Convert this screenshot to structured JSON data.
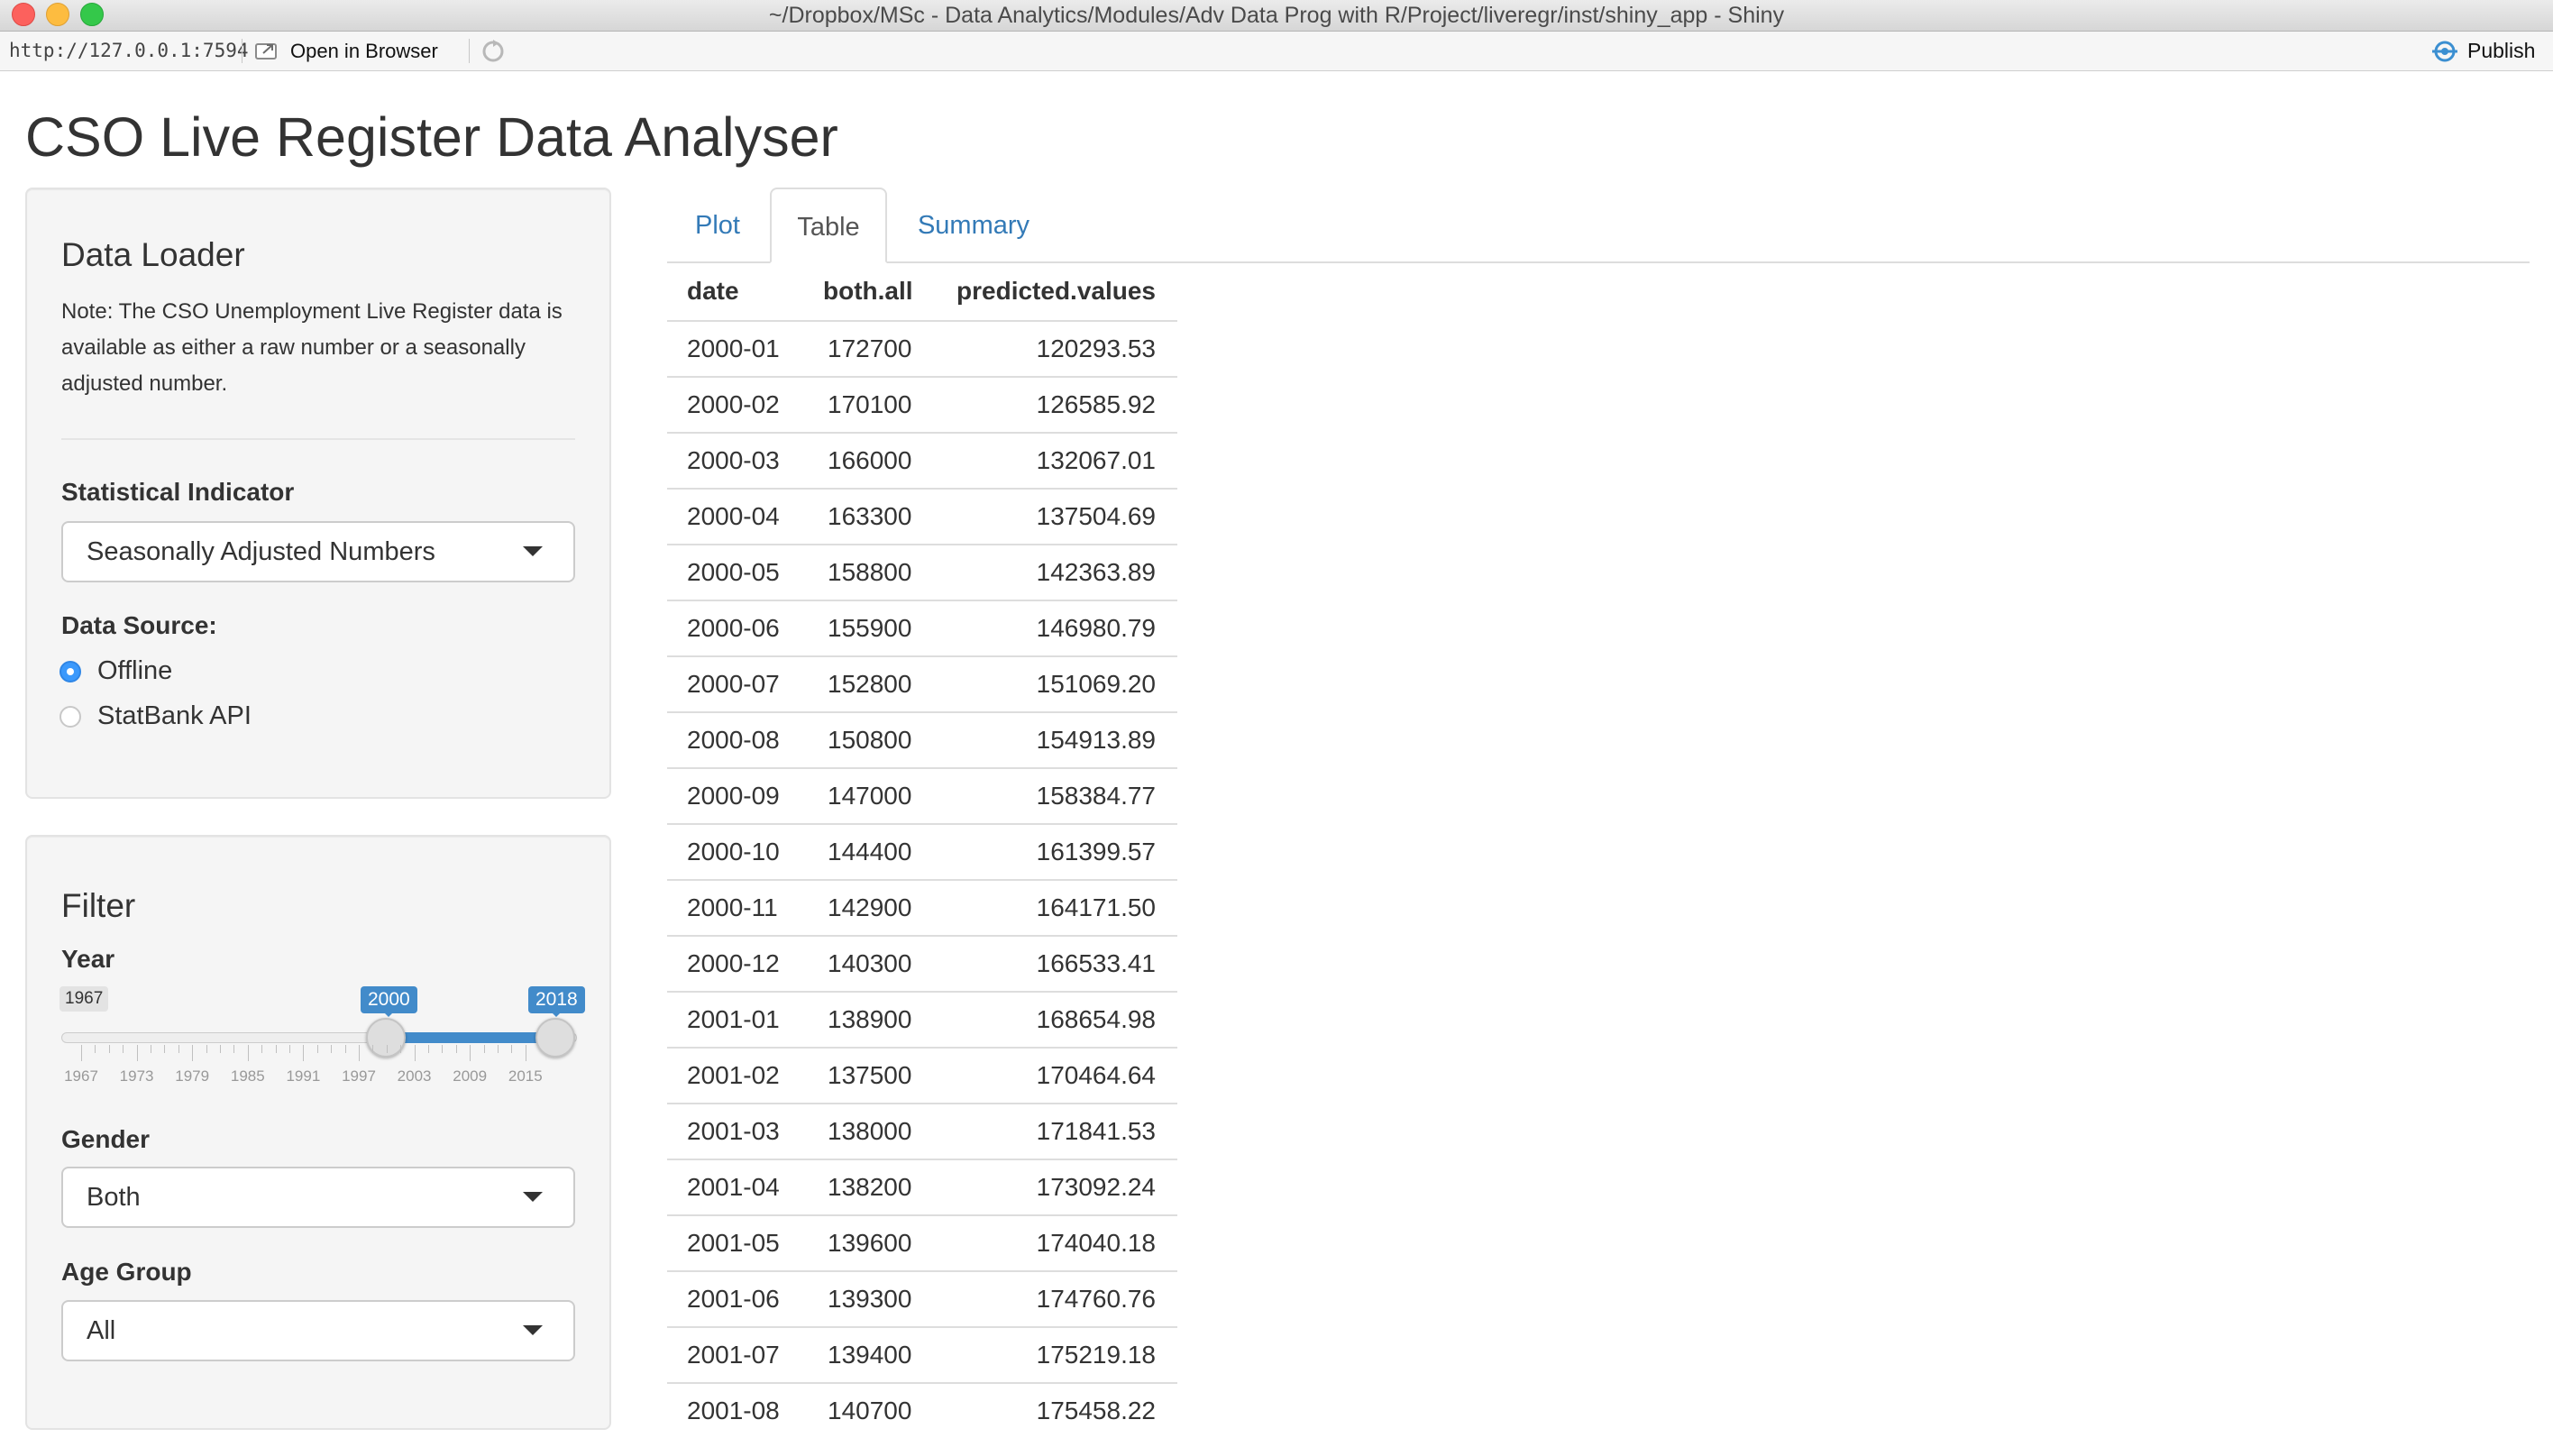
{
  "window": {
    "title": "~/Dropbox/MSc - Data Analytics/Modules/Adv Data Prog with R/Project/liveregr/inst/shiny_app - Shiny",
    "url": "http://127.0.0.1:7594",
    "open_in_browser": "Open in Browser",
    "publish": "Publish"
  },
  "app_title": "CSO Live Register Data Analyser",
  "data_loader": {
    "heading": "Data Loader",
    "note": "Note: The CSO Unemployment Live Register data is available as either a raw number or a seasonally adjusted number.",
    "indicator_label": "Statistical Indicator",
    "indicator_value": "Seasonally Adjusted Numbers",
    "source_label": "Data Source:",
    "source_options": [
      "Offline",
      "StatBank API"
    ],
    "source_selected": "Offline"
  },
  "filter": {
    "heading": "Filter",
    "year_label": "Year",
    "year_min": "1967",
    "year_from": "2000",
    "year_to": "2018",
    "year_ticks": [
      "1967",
      "1973",
      "1979",
      "1985",
      "1991",
      "1997",
      "2003",
      "2009",
      "2015"
    ],
    "gender_label": "Gender",
    "gender_value": "Both",
    "age_label": "Age Group",
    "age_value": "All"
  },
  "tabs": [
    "Plot",
    "Table",
    "Summary"
  ],
  "active_tab": "Table",
  "table": {
    "columns": [
      "date",
      "both.all",
      "predicted.values"
    ],
    "rows": [
      [
        "2000-01",
        "172700",
        "120293.53"
      ],
      [
        "2000-02",
        "170100",
        "126585.92"
      ],
      [
        "2000-03",
        "166000",
        "132067.01"
      ],
      [
        "2000-04",
        "163300",
        "137504.69"
      ],
      [
        "2000-05",
        "158800",
        "142363.89"
      ],
      [
        "2000-06",
        "155900",
        "146980.79"
      ],
      [
        "2000-07",
        "152800",
        "151069.20"
      ],
      [
        "2000-08",
        "150800",
        "154913.89"
      ],
      [
        "2000-09",
        "147000",
        "158384.77"
      ],
      [
        "2000-10",
        "144400",
        "161399.57"
      ],
      [
        "2000-11",
        "142900",
        "164171.50"
      ],
      [
        "2000-12",
        "140300",
        "166533.41"
      ],
      [
        "2001-01",
        "138900",
        "168654.98"
      ],
      [
        "2001-02",
        "137500",
        "170464.64"
      ],
      [
        "2001-03",
        "138000",
        "171841.53"
      ],
      [
        "2001-04",
        "138200",
        "173092.24"
      ],
      [
        "2001-05",
        "139600",
        "174040.18"
      ],
      [
        "2001-06",
        "139300",
        "174760.76"
      ],
      [
        "2001-07",
        "139400",
        "175219.18"
      ],
      [
        "2001-08",
        "140700",
        "175458.22"
      ]
    ]
  },
  "colors": {
    "accent": "#428bca",
    "link": "#337ab7",
    "radio_selected": "#3b99fc"
  }
}
